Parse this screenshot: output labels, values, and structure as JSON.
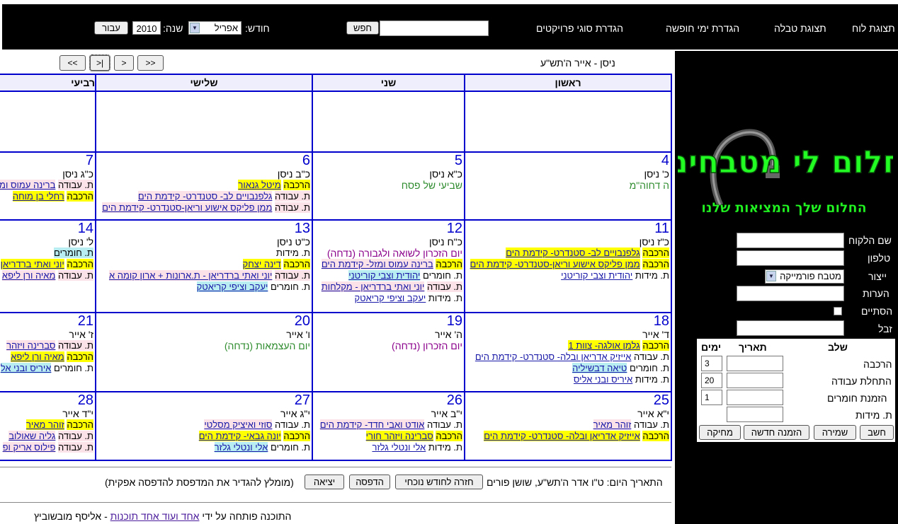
{
  "nav": {
    "items": [
      "תצוגת לוח",
      "תצוגת טבלה",
      "הגדרת ימי חופשה",
      "הגדרת סוגי פרויקטים"
    ],
    "search_button": "חפש",
    "month_label": "חודש:",
    "month_value": "אפריל",
    "year_label": "שנה:",
    "year_value": "2010",
    "go_button": "עבור"
  },
  "calendar": {
    "hebrew_period": "ניסן - אייר ה'תש\"ע",
    "nav_buttons": [
      "<<",
      "<",
      "|<",
      ">>"
    ],
    "day_headers": [
      "ראשון",
      "שני",
      "שלישי",
      "רביעי"
    ],
    "weeks": [
      {
        "days": [
          {
            "num": "",
            "heb": "",
            "items": []
          },
          {
            "num": "",
            "heb": "",
            "items": []
          },
          {
            "num": "",
            "heb": "",
            "items": []
          },
          {
            "num": "",
            "heb": "",
            "items": []
          }
        ]
      },
      {
        "days": [
          {
            "num": "4",
            "heb": "כ' ניסן",
            "holiday": "ה דחוה\"מ",
            "holiday_color": "g",
            "items": []
          },
          {
            "num": "5",
            "heb": "כ\"א ניסן",
            "holiday": "שביעי של פסח",
            "holiday_color": "g",
            "items": []
          },
          {
            "num": "6",
            "heb": "כ\"ב ניסן",
            "items": [
              {
                "prefix": "הרכבה",
                "prefix_style": "y",
                "link": "מיטל גנאור",
                "link_style": "y"
              },
              {
                "prefix": "ת. עבודה",
                "prefix_style": "p",
                "link": "גלפנבויים לב- סטנדרט- קידמת הים",
                "link_style": "p"
              },
              {
                "prefix": "ת. עבודה",
                "prefix_style": "p",
                "link": "ממן פליקס אישוע וריאן-סטנדרט- קידמת הים",
                "link_style": "p"
              }
            ]
          },
          {
            "num": "7",
            "heb": "כ\"ג ניסן",
            "items": [
              {
                "prefix": "ת. עבודה",
                "prefix_style": "p",
                "link": "ברינה עמוס ומזל",
                "link_style": "p"
              },
              {
                "prefix": "הרכבה",
                "prefix_style": "y",
                "link": "רחלי בן מוחה",
                "link_style": "y"
              }
            ]
          }
        ]
      },
      {
        "days": [
          {
            "num": "11",
            "heb": "כ\"ז ניסן",
            "items": [
              {
                "prefix": "הרכבה",
                "prefix_style": "y",
                "link": "גלפנבויים לב- סטנדרט- קידמת הים",
                "link_style": "y"
              },
              {
                "prefix": "הרכבה",
                "prefix_style": "y",
                "link": "ממן פליקס אישוע וריאן-סטנדרט- קידמת הים",
                "link_style": "y"
              },
              {
                "prefix": "ת. מידות",
                "prefix_style": "",
                "link": "יהודית וצבי קוריטני",
                "link_style": ""
              }
            ]
          },
          {
            "num": "12",
            "heb": "כ\"ח ניסן",
            "holiday": "יום הזכרון לשואה ולגבורה (נדחה)",
            "holiday_color": "p",
            "items": [
              {
                "prefix": "הרכבה",
                "prefix_style": "y",
                "link": "ברינה עמוס ומזל- קידמת הים",
                "link_style": "p"
              },
              {
                "prefix": "ת. חומרים",
                "prefix_style": "",
                "link": "יהודית וצבי קוריטני",
                "link_style": "c"
              },
              {
                "prefix": "ת. עבודה",
                "prefix_style": "p",
                "link": "יוני ואתי ברדריאן - מקלחות",
                "link_style": "p"
              },
              {
                "prefix": "ת. מידות",
                "prefix_style": "",
                "link": "יעקב וציפי קריאטק",
                "link_style": ""
              }
            ]
          },
          {
            "num": "13",
            "heb": "כ\"ט ניסן",
            "items": [
              {
                "prefix": "ת. מידות",
                "prefix_style": "",
                "link": "",
                "link_style": ""
              },
              {
                "prefix": "הרכבה",
                "prefix_style": "y",
                "link": "דינה יצחק",
                "link_style": "y"
              },
              {
                "prefix": "ת. עבודה",
                "prefix_style": "p",
                "link": "יוני ואתי ברדריאן - ת.ארונות + ארון קומה א",
                "link_style": "p"
              },
              {
                "prefix": "ת. חומרים",
                "prefix_style": "",
                "link": "יעקב וציפי קריאטק",
                "link_style": "c"
              }
            ]
          },
          {
            "num": "14",
            "heb": "ל' ניסן",
            "items": [
              {
                "prefix": "ת. חומרים",
                "prefix_style": "c",
                "link": "",
                "link_style": ""
              },
              {
                "prefix": "הרכבה",
                "prefix_style": "y",
                "link": "יוני ואתי ברדריאן",
                "link_style": "y"
              },
              {
                "prefix": "ת. עבודה",
                "prefix_style": "p",
                "link": "מאיה ורן ליפא",
                "link_style": "p"
              }
            ]
          }
        ]
      },
      {
        "days": [
          {
            "num": "18",
            "heb": "ד' אייר",
            "items": [
              {
                "prefix": "הרכבה",
                "prefix_style": "y",
                "link": "גלמן אולגה- צוות 1",
                "link_style": "y"
              },
              {
                "prefix": "ת. עבודה",
                "prefix_style": "",
                "link": "אייזיק אדריאן ובלה- סטנדרט- קידמת הים",
                "link_style": ""
              },
              {
                "prefix": "ת. חומרים",
                "prefix_style": "",
                "link": "טיאה דבשיליה",
                "link_style": "c"
              },
              {
                "prefix": "ת. מידות",
                "prefix_style": "",
                "link": "איריס ובני אליס",
                "link_style": ""
              }
            ]
          },
          {
            "num": "19",
            "heb": "ה' אייר",
            "holiday": "יום הזכרון (נדחה)",
            "holiday_color": "p",
            "items": []
          },
          {
            "num": "20",
            "heb": "ו' אייר",
            "holiday": "יום העצמאות (נדחה)",
            "holiday_color": "g",
            "items": []
          },
          {
            "num": "21",
            "heb": "ז' אייר",
            "items": [
              {
                "prefix": "ת. עבודה",
                "prefix_style": "p",
                "link": "סברינה ויזהר",
                "link_style": "p"
              },
              {
                "prefix": "הרכבה",
                "prefix_style": "y",
                "link": "מאיה ורן ליפא",
                "link_style": "y"
              },
              {
                "prefix": "ת. חומרים",
                "prefix_style": "",
                "link": "איריס ובני אל",
                "link_style": "c"
              }
            ]
          }
        ]
      },
      {
        "days": [
          {
            "num": "25",
            "heb": "י\"א אייר",
            "items": [
              {
                "prefix": "ת. עבודה",
                "prefix_style": "",
                "link": "זוהר מאיר",
                "link_style": "p"
              },
              {
                "prefix": "הרכבה",
                "prefix_style": "y",
                "link": "אייזיק אדריאן ובלה- סטנדרט- קידמת הים",
                "link_style": "y"
              }
            ]
          },
          {
            "num": "26",
            "heb": "י\"ב אייר",
            "items": [
              {
                "prefix": "ת. עבודה",
                "prefix_style": "",
                "link": "אודט ואבי חדד- קידמת הים",
                "link_style": "p"
              },
              {
                "prefix": "הרכבה",
                "prefix_style": "y",
                "link": "סברינה ויזהר חורי",
                "link_style": "y"
              },
              {
                "prefix": "ת. מידות",
                "prefix_style": "",
                "link": "אלי ונטלי גלזר",
                "link_style": ""
              }
            ]
          },
          {
            "num": "27",
            "heb": "י\"ג אייר",
            "items": [
              {
                "prefix": "ת. עבודה",
                "prefix_style": "",
                "link": "סוזי ואיציק מסלטי",
                "link_style": "p"
              },
              {
                "prefix": "הרכבה",
                "prefix_style": "y",
                "link": "יונה גבאי- קידמת הים",
                "link_style": "y"
              },
              {
                "prefix": "ת. חומרים",
                "prefix_style": "",
                "link": "אלי ונטלי גלזר",
                "link_style": "c"
              }
            ]
          },
          {
            "num": "28",
            "heb": "י\"ד אייר",
            "items": [
              {
                "prefix": "הרכבה",
                "prefix_style": "y",
                "link": "זוהר מאיר",
                "link_style": "y"
              },
              {
                "prefix": "ת. עבודה",
                "prefix_style": "p",
                "link": "גליה שאולוב",
                "link_style": "p"
              },
              {
                "prefix": "ת. עבודה",
                "prefix_style": "p",
                "link": "פילוס אריק ופ",
                "link_style": "p"
              }
            ]
          }
        ]
      }
    ]
  },
  "side": {
    "logo_title": "חלום לי מטבחים",
    "logo_subtitle": "החלום שלך המציאות שלנו",
    "labels": [
      "שם הלקוח",
      "טלפון",
      "ייצור",
      "הערות",
      "הסתיים",
      "זבל"
    ],
    "kind_value": "מטבח פורמייקה",
    "stage_headers": [
      "שלב",
      "תאריך",
      "ימים"
    ],
    "stages": [
      {
        "name": "הרכבה",
        "days": "3"
      },
      {
        "name": "התחלת עבודה",
        "days": "20"
      },
      {
        "name": "הזמנת חומרים",
        "days": "1"
      },
      {
        "name": "ת. מידות",
        "days": ""
      }
    ],
    "buttons": [
      "חשב",
      "שמירה",
      "הזמנה חדשה",
      "מחיקה"
    ]
  },
  "footer": {
    "today": "התאריך היום: ט\"ו אדר ה'תש\"ע, שושן פורים",
    "buttons": [
      "חזרה לחודש נוכחי",
      "הדפסה",
      "יציאה"
    ],
    "print_hint": "(מומלץ להגדיר את המדפסת להדפסה אפקית)",
    "credit_prefix": "התוכנה פותחה על ידי",
    "credit_link": "אחד ועוד אחד תוכנות",
    "credit_suffix": " - אליסף מובשוביץ"
  },
  "colors": {
    "grid_blue": "#0000cc",
    "highlight_yellow": "#ffff00",
    "highlight_cyan": "#b8eef2",
    "highlight_pink": "#fbe2e8",
    "logo_green": "#22ff22"
  }
}
